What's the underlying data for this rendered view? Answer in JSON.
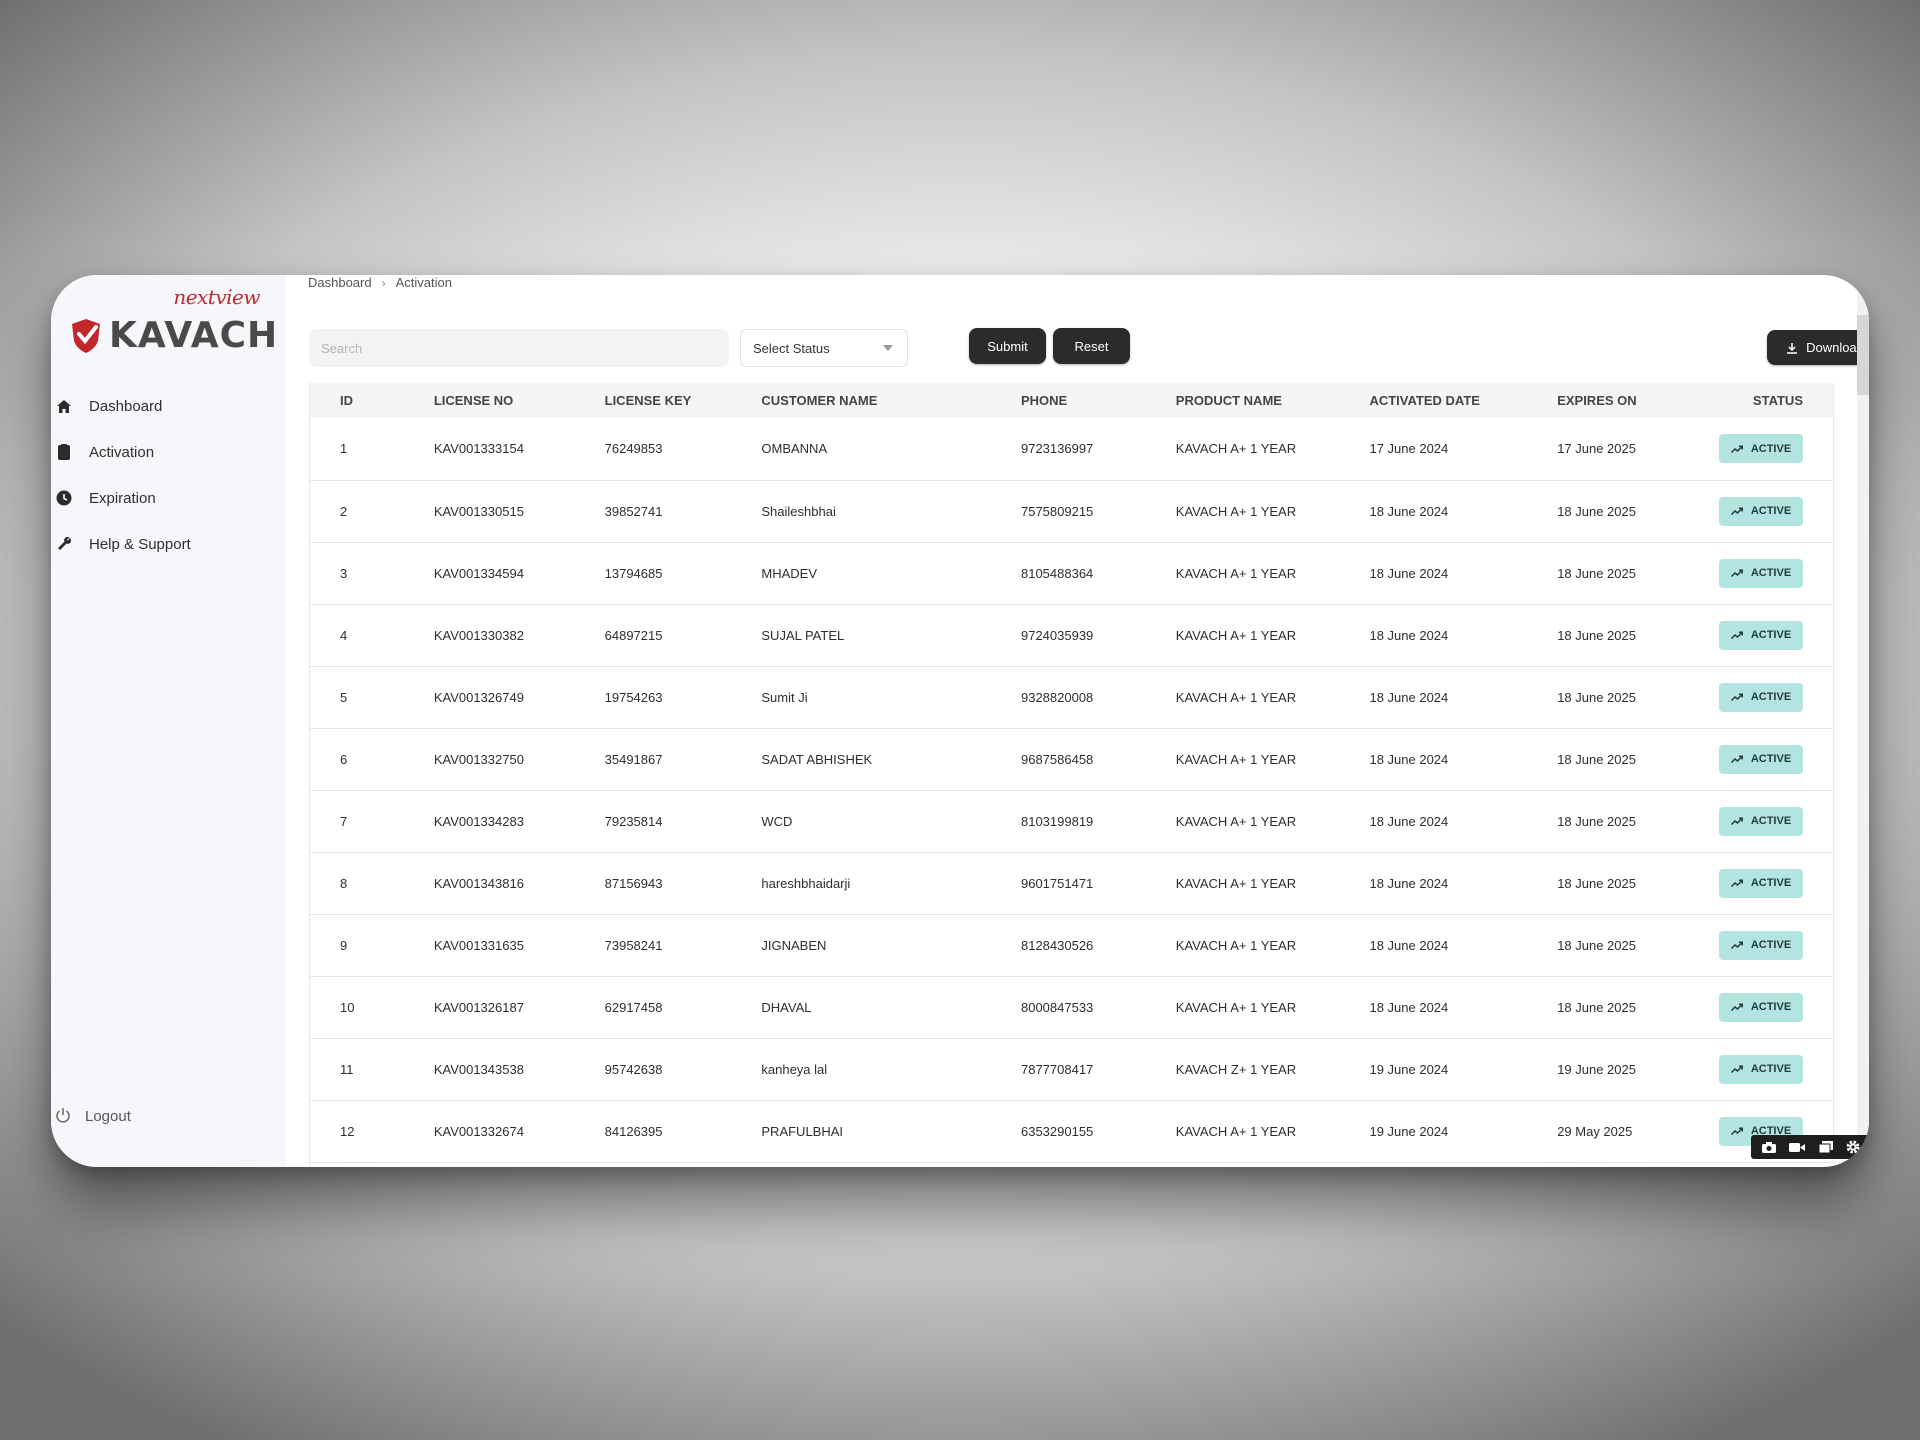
{
  "brand": {
    "top_text": "nextview",
    "main_text": "KAVACH",
    "accent": "#c0282d"
  },
  "sidebar": {
    "items": [
      {
        "label": "Dashboard",
        "icon": "home-icon"
      },
      {
        "label": "Activation",
        "icon": "clipboard-icon"
      },
      {
        "label": "Expiration",
        "icon": "clock-icon"
      },
      {
        "label": "Help & Support",
        "icon": "wrench-icon"
      }
    ],
    "logout": "Logout"
  },
  "breadcrumb": {
    "root": "Dashboard",
    "current": "Activation"
  },
  "toolbar": {
    "search_placeholder": "Search",
    "status_select": "Select Status",
    "submit": "Submit",
    "reset": "Reset",
    "download": "Download"
  },
  "table": {
    "headers": [
      "ID",
      "LICENSE NO",
      "LICENSE KEY",
      "CUSTOMER NAME",
      "PHONE",
      "PRODUCT NAME",
      "ACTIVATED DATE",
      "EXPIRES ON",
      "STATUS"
    ],
    "rows": [
      {
        "id": "1",
        "license_no": "KAV001333154",
        "license_key": "76249853",
        "customer": "OMBANNA",
        "phone": "9723136997",
        "product": "KAVACH A+ 1 YEAR",
        "activated": "17 June 2024",
        "expires": "17 June 2025",
        "status": "ACTIVE"
      },
      {
        "id": "2",
        "license_no": "KAV001330515",
        "license_key": "39852741",
        "customer": "Shaileshbhai",
        "phone": "7575809215",
        "product": "KAVACH A+ 1 YEAR",
        "activated": "18 June 2024",
        "expires": "18 June 2025",
        "status": "ACTIVE"
      },
      {
        "id": "3",
        "license_no": "KAV001334594",
        "license_key": "13794685",
        "customer": "MHADEV",
        "phone": "8105488364",
        "product": "KAVACH A+ 1 YEAR",
        "activated": "18 June 2024",
        "expires": "18 June 2025",
        "status": "ACTIVE"
      },
      {
        "id": "4",
        "license_no": "KAV001330382",
        "license_key": "64897215",
        "customer": "SUJAL PATEL",
        "phone": "9724035939",
        "product": "KAVACH A+ 1 YEAR",
        "activated": "18 June 2024",
        "expires": "18 June 2025",
        "status": "ACTIVE"
      },
      {
        "id": "5",
        "license_no": "KAV001326749",
        "license_key": "19754263",
        "customer": "Sumit Ji",
        "phone": "9328820008",
        "product": "KAVACH A+ 1 YEAR",
        "activated": "18 June 2024",
        "expires": "18 June 2025",
        "status": "ACTIVE"
      },
      {
        "id": "6",
        "license_no": "KAV001332750",
        "license_key": "35491867",
        "customer": "SADAT ABHISHEK",
        "phone": "9687586458",
        "product": "KAVACH A+ 1 YEAR",
        "activated": "18 June 2024",
        "expires": "18 June 2025",
        "status": "ACTIVE"
      },
      {
        "id": "7",
        "license_no": "KAV001334283",
        "license_key": "79235814",
        "customer": "WCD",
        "phone": "8103199819",
        "product": "KAVACH A+ 1 YEAR",
        "activated": "18 June 2024",
        "expires": "18 June 2025",
        "status": "ACTIVE"
      },
      {
        "id": "8",
        "license_no": "KAV001343816",
        "license_key": "87156943",
        "customer": "hareshbhaidarji",
        "phone": "9601751471",
        "product": "KAVACH A+ 1 YEAR",
        "activated": "18 June 2024",
        "expires": "18 June 2025",
        "status": "ACTIVE"
      },
      {
        "id": "9",
        "license_no": "KAV001331635",
        "license_key": "73958241",
        "customer": "JIGNABEN",
        "phone": "8128430526",
        "product": "KAVACH A+ 1 YEAR",
        "activated": "18 June 2024",
        "expires": "18 June 2025",
        "status": "ACTIVE"
      },
      {
        "id": "10",
        "license_no": "KAV001326187",
        "license_key": "62917458",
        "customer": "DHAVAL",
        "phone": "8000847533",
        "product": "KAVACH A+ 1 YEAR",
        "activated": "18 June 2024",
        "expires": "18 June 2025",
        "status": "ACTIVE"
      },
      {
        "id": "11",
        "license_no": "KAV001343538",
        "license_key": "95742638",
        "customer": "kanheya lal",
        "phone": "7877708417",
        "product": "KAVACH Z+ 1 YEAR",
        "activated": "19 June 2024",
        "expires": "19 June 2025",
        "status": "ACTIVE"
      },
      {
        "id": "12",
        "license_no": "KAV001332674",
        "license_key": "84126395",
        "customer": "PRAFULBHAI",
        "phone": "6353290155",
        "product": "KAVACH A+ 1 YEAR",
        "activated": "19 June 2024",
        "expires": "29 May 2025",
        "status": "ACTIVE"
      }
    ]
  },
  "recorder": {
    "icons": [
      "camera-icon",
      "video-icon",
      "window-icon",
      "gear-icon"
    ]
  },
  "colors": {
    "status_badge": "#b4e4e2",
    "dark_button": "#2b2b2b"
  }
}
